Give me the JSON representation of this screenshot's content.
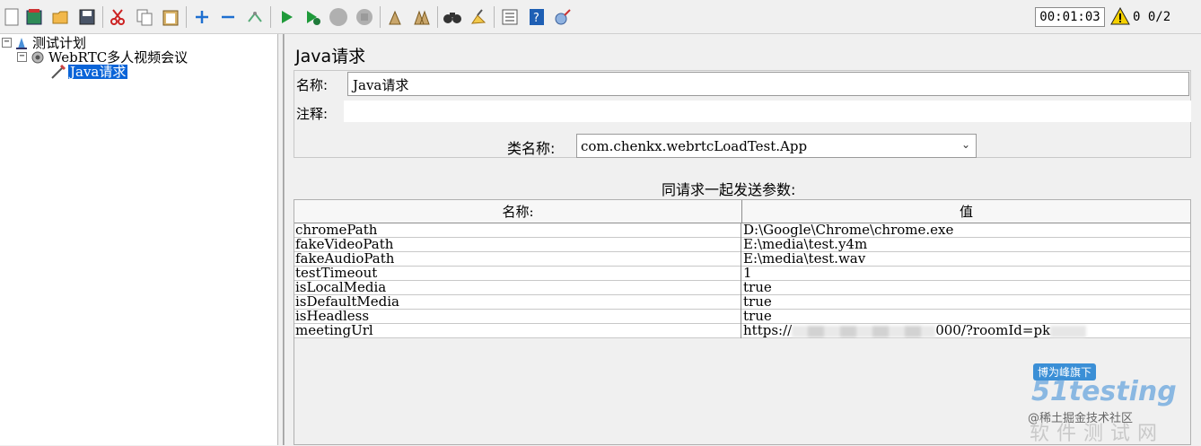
{
  "toolbar": {
    "icons": [
      "new-icon",
      "templates-icon",
      "open-icon",
      "save-icon",
      "cut-icon",
      "copy-icon",
      "paste-icon",
      "expand-icon",
      "collapse-icon",
      "toggle-icon",
      "start-icon",
      "start-no-pause-icon",
      "stop-icon",
      "shutdown-icon",
      "clear-icon",
      "clear-all-icon",
      "search-icon",
      "reset-search-icon",
      "function-helper-icon",
      "help-icon",
      "remote-icon"
    ],
    "timer": "00:01:03",
    "warnings": "0",
    "threads": "0/2"
  },
  "tree": {
    "items": [
      {
        "label": "测试计划",
        "toggle": "⊟"
      },
      {
        "label": "WebRTC多人视频会议",
        "toggle": "⊟"
      },
      {
        "label": "Java请求",
        "selected": true
      }
    ]
  },
  "panel": {
    "title": "Java请求",
    "name_label": "名称:",
    "name_value": "Java请求",
    "comment_label": "注释:",
    "comment_value": "",
    "classname_label": "类名称:",
    "classname_value": "com.chenkx.webrtcLoadTest.App",
    "params_caption": "同请求一起发送参数:",
    "columns": [
      "名称:",
      "值"
    ],
    "rows": [
      [
        "chromePath",
        "D:\\Google\\Chrome\\chrome.exe"
      ],
      [
        "fakeVideoPath",
        "E:\\media\\test.y4m"
      ],
      [
        "fakeAudioPath",
        "E:\\media\\test.wav"
      ],
      [
        "testTimeout",
        "1"
      ],
      [
        "isLocalMedia",
        "true"
      ],
      [
        "isDefaultMedia",
        "true"
      ],
      [
        "isHeadless",
        "true"
      ],
      [
        "meetingUrl",
        ""
      ]
    ],
    "meeting_url_prefix": "https://",
    "meeting_url_mid": "000/?roomId=pk"
  },
  "watermark": {
    "badge": "博为峰旗下",
    "logo": "51testing",
    "credit": "@稀土掘金技术社区",
    "site": "软件测试网"
  }
}
